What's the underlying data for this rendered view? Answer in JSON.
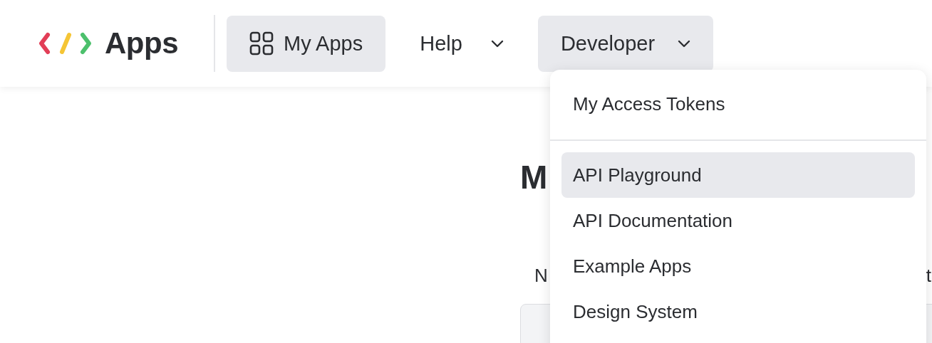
{
  "header": {
    "brand": "Apps",
    "nav": [
      {
        "kind": "link",
        "label": "My Apps",
        "selected": true
      },
      {
        "kind": "dropdown",
        "label": "Help",
        "expanded": false
      },
      {
        "kind": "dropdown",
        "label": "Developer",
        "expanded": true
      }
    ]
  },
  "developer_menu": {
    "sections": [
      [
        "My Access Tokens"
      ],
      [
        {
          "label": "API Playground",
          "selected": true
        },
        {
          "label": "API Documentation",
          "selected": false
        },
        {
          "label": "Example Apps",
          "selected": false
        },
        {
          "label": "Design System",
          "selected": false
        }
      ]
    ]
  },
  "page": {
    "heading": "M",
    "text_left": "N",
    "text_right": "t"
  }
}
